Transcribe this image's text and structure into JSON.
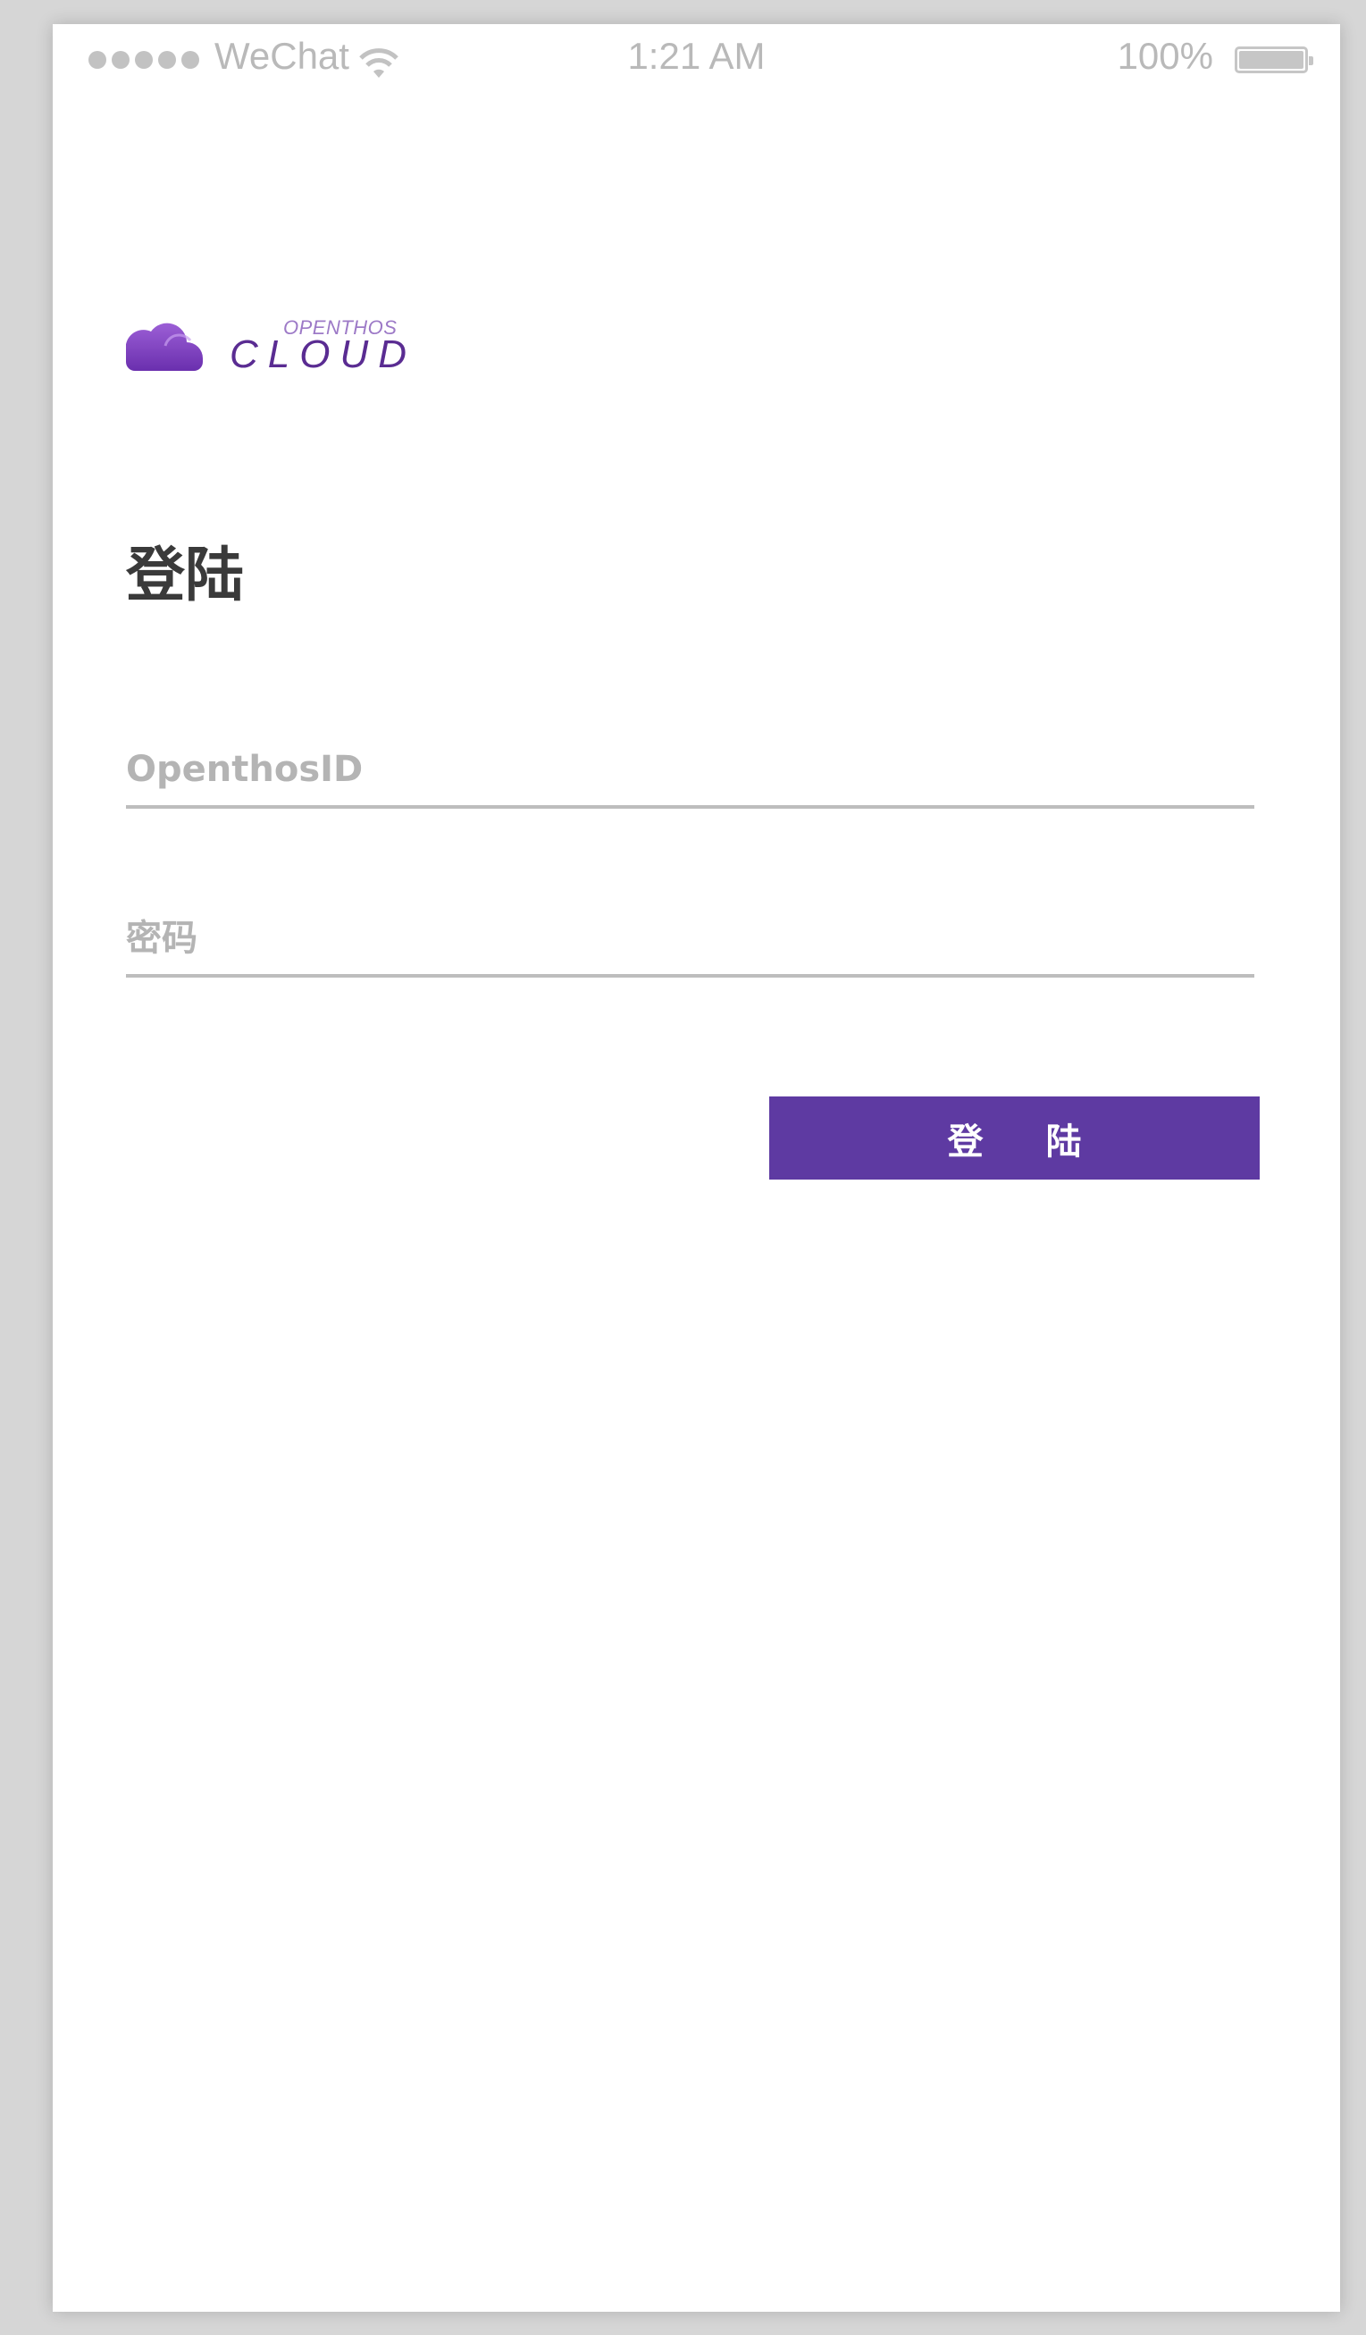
{
  "status_bar": {
    "carrier": "WeChat",
    "time": "1:21 AM",
    "battery_percent": "100%",
    "icons": [
      "signal-dots-icon",
      "wifi-icon",
      "battery-icon"
    ]
  },
  "logo": {
    "small_text": "OPENTHOS",
    "big_text": "CLOUD",
    "icon": "cloud-icon"
  },
  "page": {
    "title": "登陆"
  },
  "form": {
    "id_placeholder": "OpenthosID",
    "id_value": "",
    "password_placeholder": "密码",
    "password_value": "",
    "login_label": "登 陆"
  },
  "colors": {
    "accent": "#5e3aa2",
    "logo_text": "#5a2c92",
    "placeholder": "#b4b4b4",
    "underline": "#bdbdbd"
  }
}
